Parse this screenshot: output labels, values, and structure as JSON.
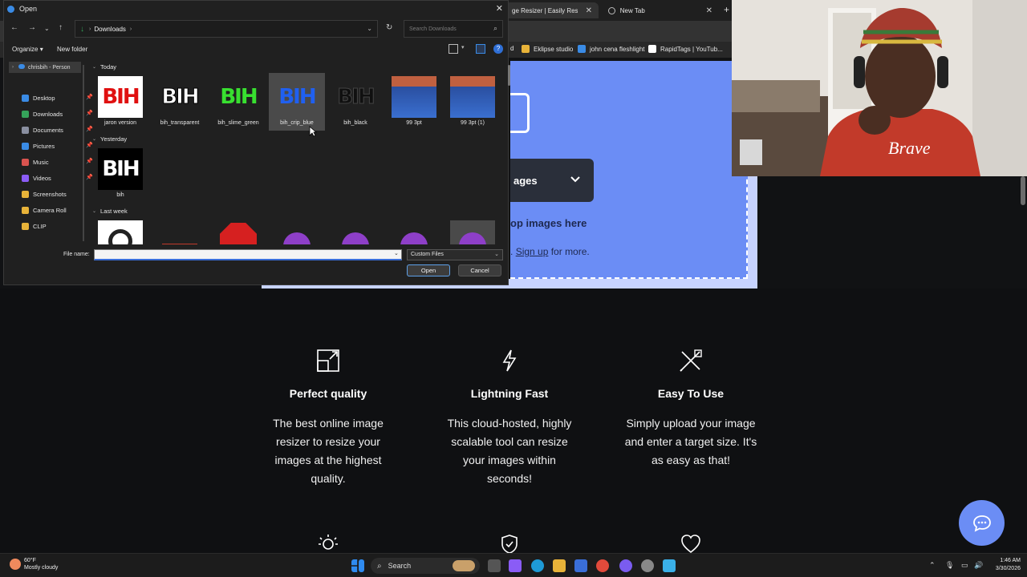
{
  "browser": {
    "tabs": [
      {
        "label": "ge Resizer | Easily Resize Im"
      },
      {
        "label": "New Tab"
      }
    ],
    "bookmarks": [
      {
        "label": "d"
      },
      {
        "label": "Eklipse studio"
      },
      {
        "label": "john cena fleshlight"
      },
      {
        "label": "RapidTags | YouTub..."
      }
    ]
  },
  "page": {
    "select_button_label": "ages",
    "drop_text": "op images here",
    "signup_prefix": ".",
    "signup_link": "Sign up",
    "signup_suffix": " for more.",
    "features": [
      {
        "title": "Perfect quality",
        "icon": "resize-icon",
        "desc": "The best online image resizer to resize your images at the highest quality."
      },
      {
        "title": "Lightning Fast",
        "icon": "lightning-icon",
        "desc": "This cloud-hosted, highly scalable tool can resize your images within seconds!"
      },
      {
        "title": "Easy To Use",
        "icon": "tools-icon",
        "desc": "Simply upload your image and enter a target size. It's as easy as that!"
      }
    ],
    "bottom_icons": [
      "lightbulb-icon",
      "shield-check-icon",
      "heart-icon"
    ]
  },
  "dialog": {
    "title": "Open",
    "path": "Downloads",
    "search_placeholder": "Search Downloads",
    "organize_label": "Organize",
    "new_folder_label": "New folder",
    "nav_top": "chrisbih - Person",
    "nav_items": [
      {
        "label": "Desktop",
        "color": "#3a8be5",
        "pinned": true
      },
      {
        "label": "Downloads",
        "color": "#35a35a",
        "pinned": true
      },
      {
        "label": "Documents",
        "color": "#8a8fa0",
        "pinned": true
      },
      {
        "label": "Pictures",
        "color": "#3a8be5",
        "pinned": true
      },
      {
        "label": "Music",
        "color": "#d9534f",
        "pinned": true
      },
      {
        "label": "Videos",
        "color": "#8b5cf6",
        "pinned": true
      },
      {
        "label": "Screenshots",
        "color": "#e8b339",
        "pinned": false
      },
      {
        "label": "Camera Roll",
        "color": "#e8b339",
        "pinned": false
      },
      {
        "label": "CLIP",
        "color": "#e8b339",
        "pinned": false
      }
    ],
    "groups": {
      "today": "Today",
      "yesterday": "Yesterday",
      "last_week": "Last week"
    },
    "today_files": [
      {
        "name": "jaron version",
        "thumb_text": "BIH",
        "fg": "#e01010",
        "bg": "#000000"
      },
      {
        "name": "bih_transparent",
        "thumb_text": "BIH",
        "fg": "#ffffff",
        "bg": "#202020"
      },
      {
        "name": "bih_slime_green",
        "thumb_text": "BIH",
        "fg": "#38e030",
        "bg": "#202020"
      },
      {
        "name": "bih_crip_blue",
        "thumb_text": "BIH",
        "fg": "#2060f0",
        "bg": "#4a4a4a"
      },
      {
        "name": "bih_black",
        "thumb_text": "BIH",
        "fg": "#101010",
        "bg": "#202020"
      },
      {
        "name": "99 3pt",
        "thumb_text": "",
        "fg": "#2a4fa0",
        "bg": "#c06040"
      },
      {
        "name": "99 3pt (1)",
        "thumb_text": "",
        "fg": "#2a4fa0",
        "bg": "#c06040"
      }
    ],
    "yesterday_files": [
      {
        "name": "bih",
        "thumb_text": "BIH",
        "fg": "#ffffff",
        "bg": "#000000"
      }
    ],
    "file_name_label": "File name:",
    "file_name_value": "",
    "file_type": "Custom Files",
    "open_label": "Open",
    "cancel_label": "Cancel"
  },
  "taskbar": {
    "temp": "60°F",
    "condition": "Mostly cloudy",
    "search_label": "Search",
    "time": "1:46 AM",
    "date": "3/30/2026"
  }
}
